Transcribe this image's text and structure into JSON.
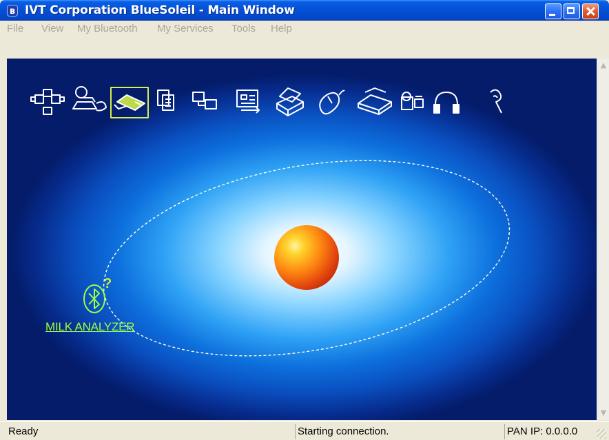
{
  "window": {
    "title": "IVT Corporation BlueSoleil - Main Window",
    "app_icon_glyph": "ʙ"
  },
  "menu": {
    "items": [
      "File",
      "View",
      "My Bluetooth",
      "My Services",
      "Tools",
      "Help"
    ]
  },
  "toolbar": {
    "service_icons": [
      "network-access-icon",
      "dialup-networking-icon",
      "serial-port-icon",
      "file-transfer-icon",
      "personal-area-network-icon",
      "information-exchange-icon",
      "printer-icon",
      "mouse-icon",
      "fax-icon",
      "camera-icon",
      "headset-icon",
      "earpiece-icon"
    ],
    "selected_icon": "serial-port-icon"
  },
  "scene": {
    "device_name": "MILK ANALYZER",
    "device_status_glyph": "?",
    "colors": {
      "device_accent": "#9dff3f",
      "orbit": "#ffffe8",
      "sun_core": "#ffd12a",
      "sun_edge": "#c2290b"
    }
  },
  "status": {
    "left": "Ready",
    "middle": "Starting connection.",
    "right": "PAN IP: 0.0.0.0"
  }
}
